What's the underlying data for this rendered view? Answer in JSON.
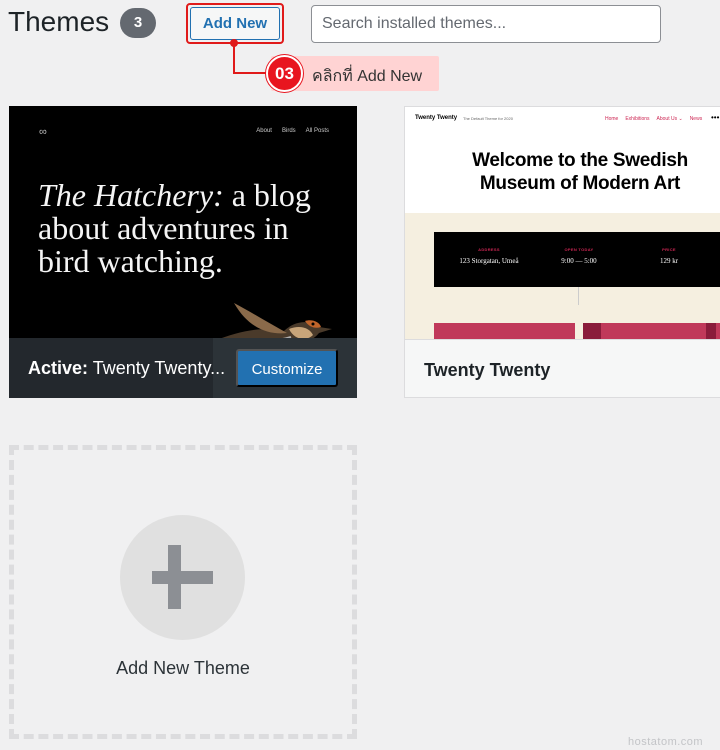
{
  "header": {
    "title": "Themes",
    "count": "3",
    "add_new_label": "Add New",
    "search_placeholder": "Search installed themes..."
  },
  "callout": {
    "step_number": "03",
    "text": "คลิกที่ Add New",
    "color": "#e8151f"
  },
  "themes": [
    {
      "preview": {
        "nav": [
          "About",
          "Birds",
          "All Posts"
        ],
        "headline_italic": "The Hatchery:",
        "headline_rest": " a blog about adventures in bird watching."
      },
      "active_prefix": "Active:",
      "name": "Twenty Twenty...",
      "customize_label": "Customize"
    },
    {
      "preview": {
        "site_title": "Twenty Twenty",
        "tagline": "The Default Theme for 2020",
        "nav": [
          "Home",
          "Exhibitions",
          "About Us ⌄",
          "News"
        ],
        "headline": "Welcome to the Swedish Museum of Modern Art",
        "info": [
          {
            "label": "ADDRESS",
            "value": "123 Storgatan, Umeå"
          },
          {
            "label": "OPEN TODAY",
            "value": "9:00 — 5:00"
          },
          {
            "label": "PRICE",
            "value": "129 kr"
          }
        ]
      },
      "name": "Twenty Twenty"
    }
  ],
  "add_theme": {
    "label": "Add New Theme"
  },
  "watermark": "hostatom.com",
  "colors": {
    "accent": "#2271b1",
    "background": "#f0f0f1",
    "callout_red": "#e01a1a"
  }
}
